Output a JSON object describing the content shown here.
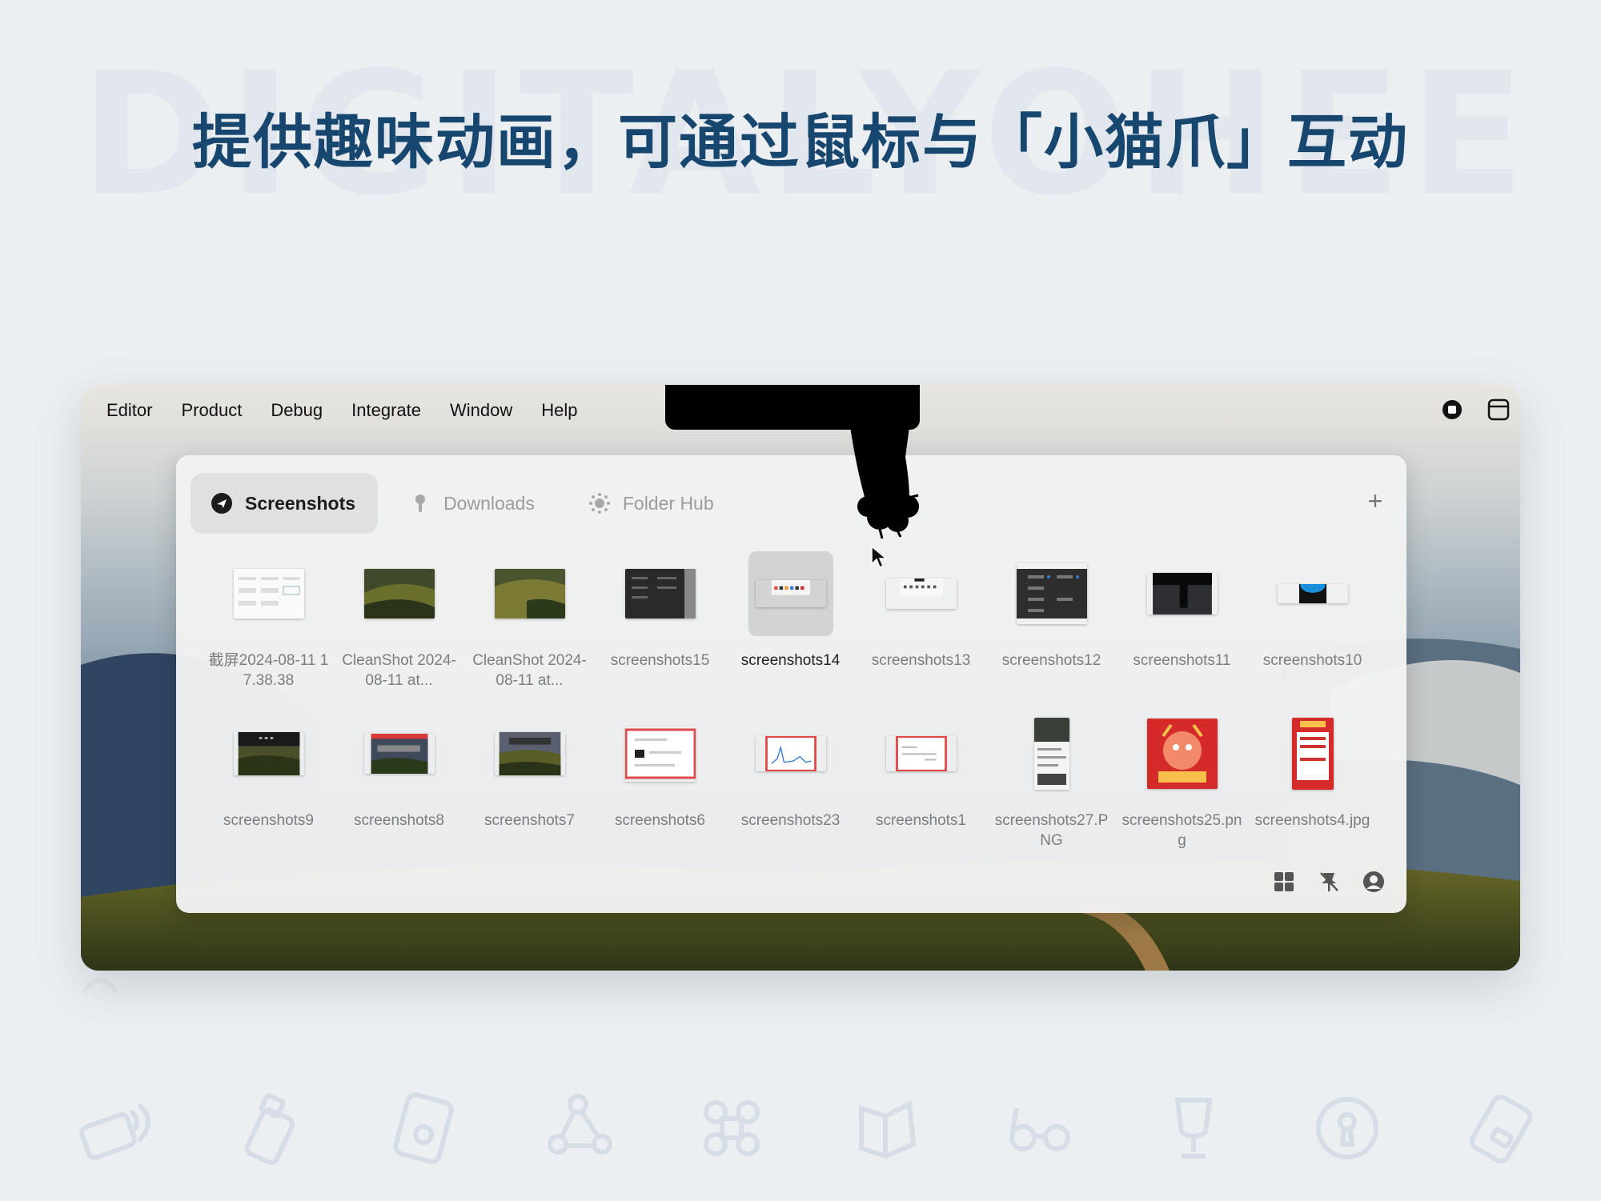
{
  "watermark": "DIGITALYOHEE",
  "headline": "提供趣味动画，可通过鼠标与「小猫爪」互动",
  "menubar": {
    "items": [
      "Editor",
      "Product",
      "Debug",
      "Integrate",
      "Window",
      "Help"
    ],
    "tray_icons": [
      "record-icon",
      "clipboard-icon"
    ]
  },
  "panel": {
    "tabs": [
      {
        "label": "Screenshots",
        "icon": "plane-icon",
        "active": true
      },
      {
        "label": "Downloads",
        "icon": "pin-icon",
        "active": false
      },
      {
        "label": "Folder Hub",
        "icon": "sparkle-icon",
        "active": false
      }
    ],
    "add_label": "+",
    "items": [
      {
        "label": "截屏2024-08-11 17.38.38",
        "thumb": "form"
      },
      {
        "label": "CleanShot 2024-08-11 at...",
        "thumb": "landscape"
      },
      {
        "label": "CleanShot 2024-08-11 at...",
        "thumb": "landscape2"
      },
      {
        "label": "screenshots15",
        "thumb": "dark-ui"
      },
      {
        "label": "screenshots14",
        "thumb": "light-ui",
        "selected": true
      },
      {
        "label": "screenshots13",
        "thumb": "light-ui2"
      },
      {
        "label": "screenshots12",
        "thumb": "dark-panel"
      },
      {
        "label": "screenshots11",
        "thumb": "notch-dark"
      },
      {
        "label": "screenshots10",
        "thumb": "blue-glow"
      },
      {
        "label": "screenshots9",
        "thumb": "landscape-bar"
      },
      {
        "label": "screenshots8",
        "thumb": "red-bar"
      },
      {
        "label": "screenshots7",
        "thumb": "landscape-bar2"
      },
      {
        "label": "screenshots6",
        "thumb": "red-frame"
      },
      {
        "label": "screenshots23",
        "thumb": "red-chart"
      },
      {
        "label": "screenshots1",
        "thumb": "red-frame2"
      },
      {
        "label": "screenshots27.PNG",
        "thumb": "phone"
      },
      {
        "label": "screenshots25.png",
        "thumb": "dragon"
      },
      {
        "label": "screenshots4.jpg",
        "thumb": "poster"
      }
    ],
    "footer_icons": [
      "grid-icon",
      "unpin-icon",
      "user-icon"
    ]
  },
  "colors": {
    "headline": "#17466f",
    "background": "#eceff2",
    "panel": "#f2f2f2",
    "selected": "#d3d3d3"
  }
}
